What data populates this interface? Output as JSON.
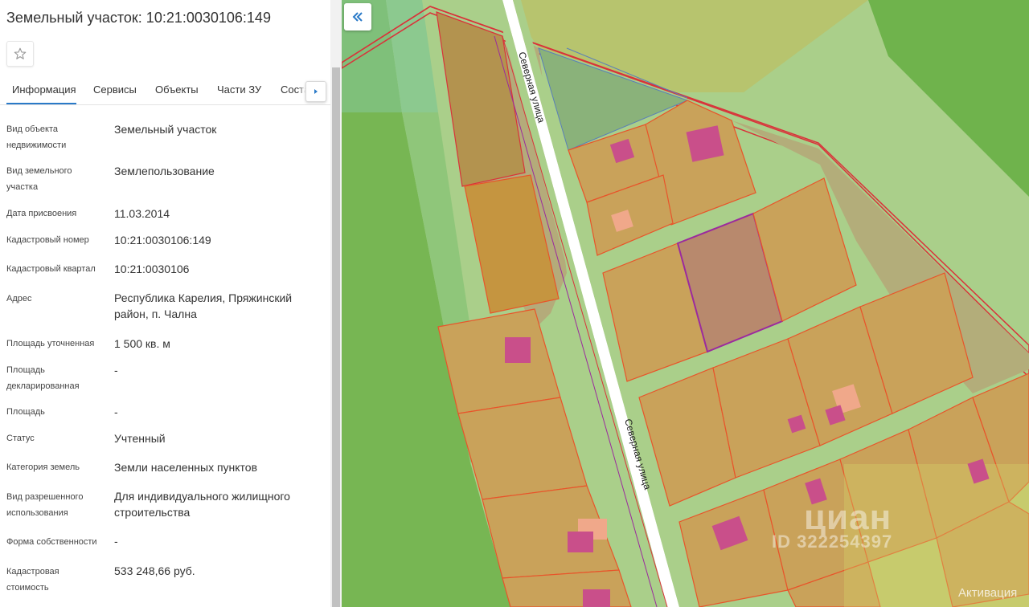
{
  "panel": {
    "title": "Земельный участок: 10:21:0030106:149",
    "tabs": [
      {
        "label": "Информация",
        "active": true
      },
      {
        "label": "Сервисы"
      },
      {
        "label": "Объекты"
      },
      {
        "label": "Части ЗУ"
      },
      {
        "label": "Соста"
      }
    ],
    "rows": [
      {
        "label": "Вид объекта недвижимости",
        "value": "Земельный участок"
      },
      {
        "label": "Вид земельного участка",
        "value": "Землепользование"
      },
      {
        "label": "Дата присвоения",
        "value": "11.03.2014"
      },
      {
        "label": "Кадастровый номер",
        "value": "10:21:0030106:149"
      },
      {
        "label": "Кадастровый квартал",
        "value": "10:21:0030106"
      },
      {
        "label": "Адрес",
        "value": "Республика Карелия, Пряжинский район, п. Чална"
      },
      {
        "label": "Площадь уточненная",
        "value": "1 500 кв. м"
      },
      {
        "label": "Площадь декларированная",
        "value": "-"
      },
      {
        "label": "Площадь",
        "value": "-"
      },
      {
        "label": "Статус",
        "value": "Учтенный"
      },
      {
        "label": "Категория земель",
        "value": "Земли населенных пунктов"
      },
      {
        "label": "Вид разрешенного использования",
        "value": "Для индивидуального жилищного строительства"
      },
      {
        "label": "Форма собственности",
        "value": "-"
      },
      {
        "label": "Кадастровая стоимость",
        "value": "533 248,66 руб."
      }
    ]
  },
  "map": {
    "street_labels": [
      "Северная улица",
      "Северная улица"
    ],
    "watermark_brand": "циан",
    "watermark_id": "ID 322254397",
    "os_activation_text": "Активация"
  },
  "colors": {
    "accent": "#2a7ac8",
    "parcel_fill": "#c9a25a",
    "parcel_border": "#e8542a",
    "selected_border": "#9b2a9e",
    "building": "#c94f8a",
    "green_light": "#aacf8a",
    "green_dark": "#72b44c"
  },
  "icons": {
    "favorite": "star-icon",
    "tab_scroll": "caret-right-icon",
    "collapse_panel": "double-chevron-left-icon"
  }
}
